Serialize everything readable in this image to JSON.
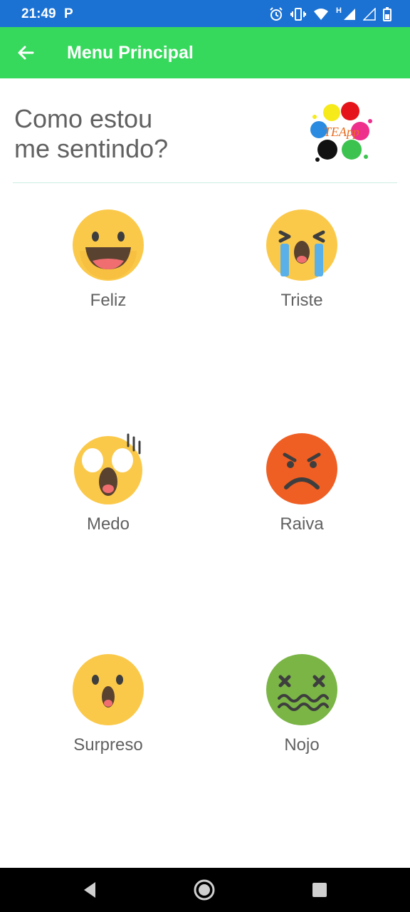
{
  "status_bar": {
    "time": "21:49",
    "app_indicator": "P",
    "network_label": "H"
  },
  "app_bar": {
    "title": "Menu Principal",
    "back_icon": "arrow-left-icon"
  },
  "header": {
    "title_line1": "Como estou",
    "title_line2": "me sentindo?",
    "logo_text": "TEApp"
  },
  "emotions": [
    {
      "label": "Feliz",
      "icon": "happy-face-icon"
    },
    {
      "label": "Triste",
      "icon": "crying-face-icon"
    },
    {
      "label": "Medo",
      "icon": "scared-face-icon"
    },
    {
      "label": "Raiva",
      "icon": "angry-face-icon"
    },
    {
      "label": "Surpreso",
      "icon": "surprised-face-icon"
    },
    {
      "label": "Nojo",
      "icon": "disgusted-face-icon"
    }
  ],
  "colors": {
    "status_bar": "#1b72d3",
    "app_bar": "#36d95c",
    "text_gray": "#616161",
    "emoji_yellow": "#fbc94a",
    "angry_orange": "#ef5e23",
    "disgust_green": "#7ab546"
  },
  "nav_bar": [
    "back-triangle-icon",
    "home-circle-icon",
    "recents-square-icon"
  ]
}
